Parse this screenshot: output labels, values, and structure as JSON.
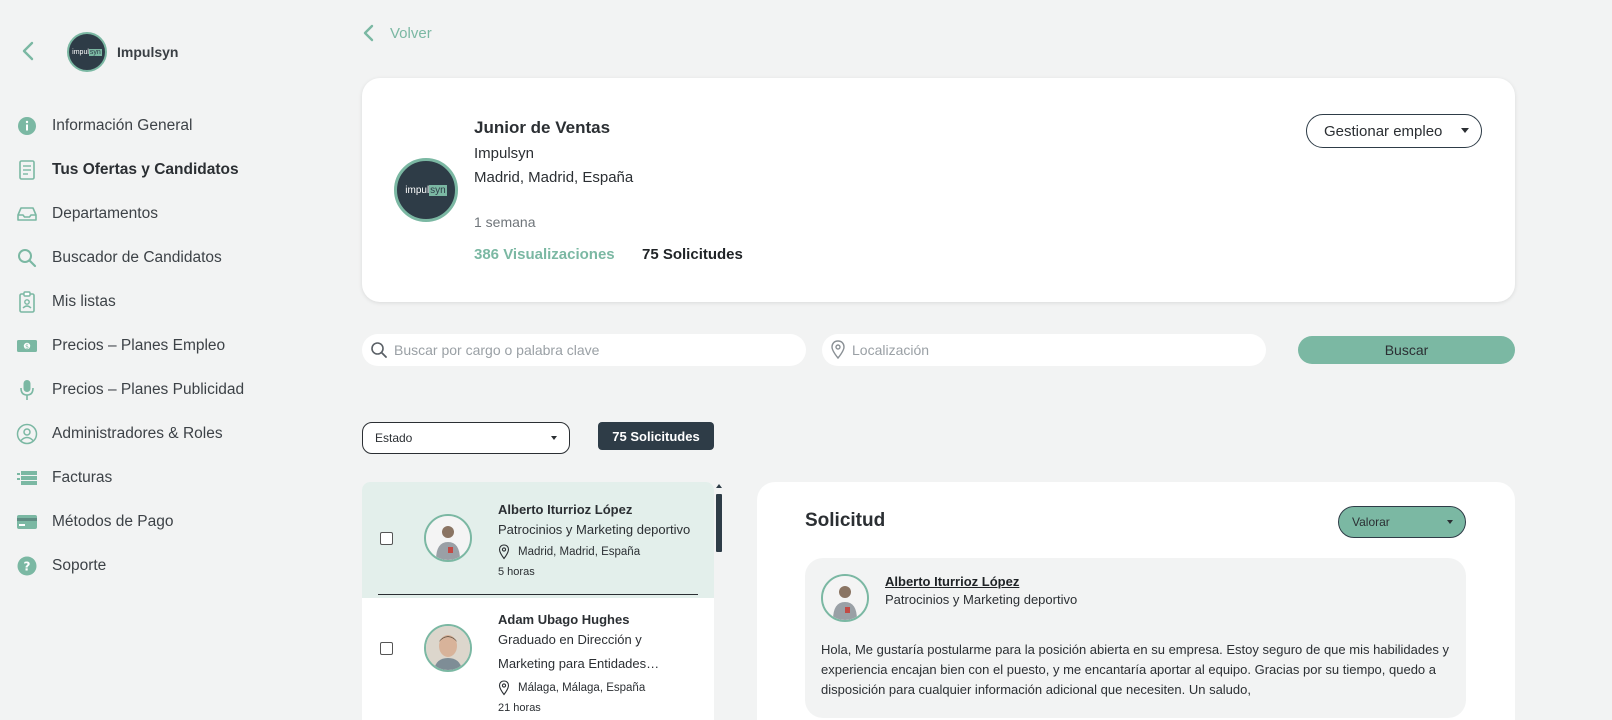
{
  "brand": {
    "logo_text_a": "impul",
    "logo_text_b": "syn",
    "name": "Impulsyn"
  },
  "sidebar": {
    "items": [
      {
        "label": "Información General",
        "icon": "info-icon"
      },
      {
        "label": "Tus Ofertas y Candidatos",
        "icon": "document-list-icon",
        "active": true
      },
      {
        "label": "Departamentos",
        "icon": "inbox-tray-icon"
      },
      {
        "label": "Buscador de Candidatos",
        "icon": "search-icon"
      },
      {
        "label": "Mis listas",
        "icon": "clipboard-person-icon"
      },
      {
        "label": "Precios – Planes Empleo",
        "icon": "banknote-icon"
      },
      {
        "label": "Precios – Planes Publicidad",
        "icon": "microphone-icon"
      },
      {
        "label": "Administradores & Roles",
        "icon": "user-circle-icon"
      },
      {
        "label": "Facturas",
        "icon": "cash-stack-icon"
      },
      {
        "label": "Métodos de Pago",
        "icon": "credit-card-icon"
      },
      {
        "label": "Soporte",
        "icon": "help-circle-icon"
      }
    ]
  },
  "back": {
    "label": "Volver"
  },
  "job": {
    "title": "Junior de Ventas",
    "company": "Impulsyn",
    "location": "Madrid, Madrid, España",
    "age": "1 semana",
    "views": "386 Visualizaciones",
    "applications": "75 Solicitudes",
    "manage_label": "Gestionar empleo"
  },
  "search": {
    "keyword_placeholder": "Buscar por cargo o palabra clave",
    "location_placeholder": "Localización",
    "button_label": "Buscar"
  },
  "filters": {
    "estado_label": "Estado",
    "count_badge": "75 Solicitudes"
  },
  "candidates": [
    {
      "name": "Alberto Iturrioz López",
      "role": "Patrocinios y Marketing deportivo",
      "location": "Madrid, Madrid, España",
      "time": "5 horas"
    },
    {
      "name": "Adam Ubago Hughes",
      "role_line1": "Graduado en Dirección y",
      "role_line2": "Marketing para Entidades…",
      "location": "Málaga, Málaga, España",
      "time": "21 horas"
    }
  ],
  "detail": {
    "title": "Solicitud",
    "rate_label": "Valorar",
    "applicant_name": "Alberto Iturrioz López",
    "applicant_role": "Patrocinios y Marketing deportivo",
    "message": "Hola, Me gustaría postularme para la posición abierta en su empresa. Estoy seguro de que mis habilidades y experiencia encajan bien con el puesto, y me encantaría aportar al equipo. Gracias por su tiempo, quedo a disposición para cualquier información adicional que necesiten. Un saludo,"
  },
  "colors": {
    "accent": "#7bb8a3",
    "dark": "#2e3c47",
    "background": "#f2f3f3",
    "selected_row": "#e3efeb"
  }
}
